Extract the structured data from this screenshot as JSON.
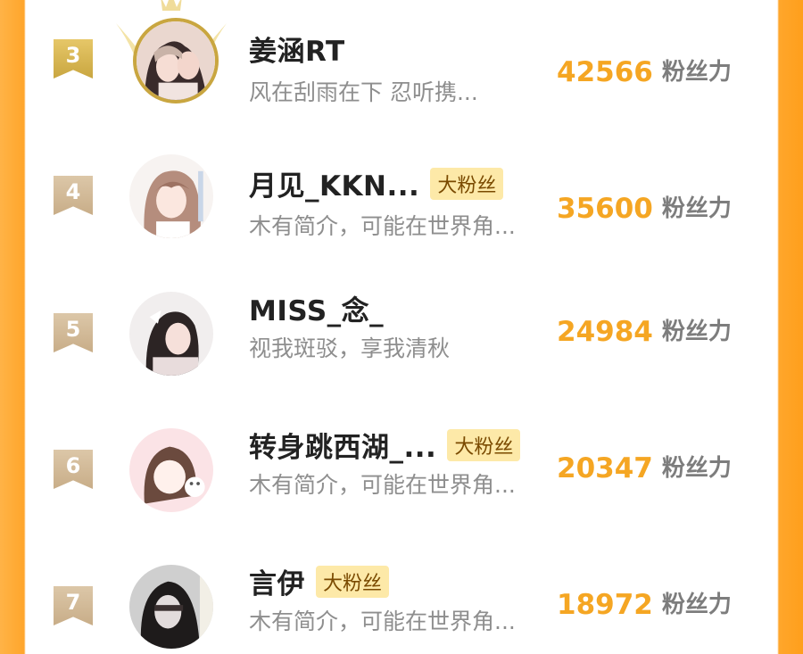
{
  "colors": {
    "accent": "#f5a623",
    "fan_tag_bg": "#fde9a8",
    "name": "#222222",
    "bio": "#8e8e8e",
    "score_unit": "#7d7d7d"
  },
  "fans": [
    {
      "rank": "3",
      "name": "姜涵RT",
      "tag": "",
      "bio": "风在刮雨在下 忍听携...",
      "score": "42566",
      "unit": "粉丝力",
      "avatar_icon": "avatar-photo-icon"
    },
    {
      "rank": "4",
      "name": "月见_KKN...",
      "tag": "大粉丝",
      "bio": "木有简介，可能在世界角...",
      "score": "35600",
      "unit": "粉丝力",
      "avatar_icon": "avatar-photo-icon"
    },
    {
      "rank": "5",
      "name": "MISS_念_",
      "tag": "",
      "bio": "视我斑驳，享我清秋",
      "score": "24984",
      "unit": "粉丝力",
      "avatar_icon": "avatar-photo-icon"
    },
    {
      "rank": "6",
      "name": "转身跳西湖_...",
      "tag": "大粉丝",
      "bio": "木有简介，可能在世界角...",
      "score": "20347",
      "unit": "粉丝力",
      "avatar_icon": "avatar-photo-icon"
    },
    {
      "rank": "7",
      "name": "言伊",
      "tag": "大粉丝",
      "bio": "木有简介，可能在世界角...",
      "score": "18972",
      "unit": "粉丝力",
      "avatar_icon": "avatar-photo-icon"
    }
  ]
}
